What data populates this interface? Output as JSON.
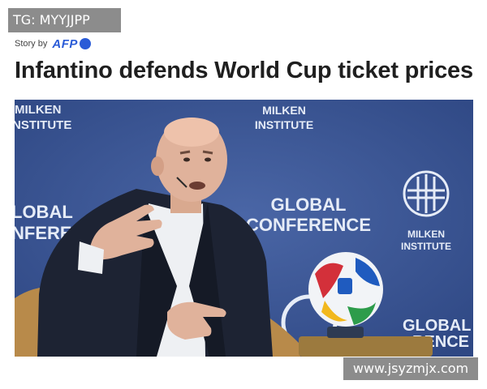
{
  "badge": {
    "text": "TG: MYYJJPP"
  },
  "byline": {
    "prefix": "Story by",
    "source": "AFP"
  },
  "headline": "Infantino defends World Cup ticket prices",
  "photo": {
    "backdrop": {
      "milken_top_left": [
        "MILKEN",
        "NSTITUTE"
      ],
      "milken_top_center": [
        "MILKEN",
        "INSTITUTE"
      ],
      "global_left": [
        "LOBAL",
        "NFEREN"
      ],
      "global_center": [
        "GLOBAL",
        "CONFERENCE"
      ],
      "milken_right": [
        "MILKEN",
        "INSTITUTE"
      ],
      "global_bottom_right": [
        "GLOBAL",
        "RENCE"
      ]
    }
  },
  "watermark": {
    "text": "www.jsyzmjx.com"
  },
  "colors": {
    "backdrop": "#3a5594",
    "jacket": "#1d2333",
    "chair": "#b88a4a",
    "afp_blue": "#2a5bd7"
  }
}
